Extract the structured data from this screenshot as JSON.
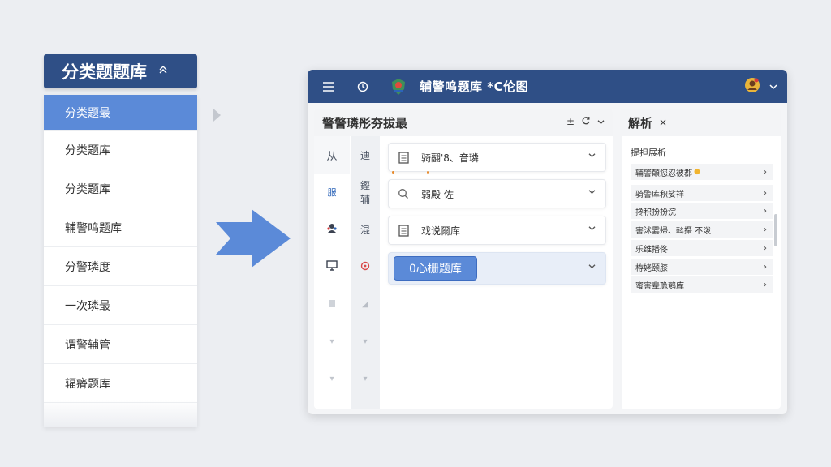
{
  "category_panel": {
    "header": "分类题题库",
    "items": [
      {
        "label": "分类题最",
        "active": true
      },
      {
        "label": "分类题库",
        "active": false
      },
      {
        "label": "分类题库",
        "active": false
      },
      {
        "label": "辅警呜题库",
        "active": false
      },
      {
        "label": "分警璘度",
        "active": false
      },
      {
        "label": "一次璘最",
        "active": false
      },
      {
        "label": "谓警辅管",
        "active": false
      },
      {
        "label": "辐瘠题库",
        "active": false
      }
    ]
  },
  "app": {
    "title": "辅警呜题库 *C伦图",
    "main": {
      "title": "警警璘彤夯拔最",
      "tools_label": "±",
      "rail1": [
        "从",
        "服",
        "",
        "",
        "",
        "",
        ""
      ],
      "rail2": [
        "迪",
        "鏗",
        "辅",
        "混",
        "",
        "",
        ""
      ],
      "items": [
        {
          "label": "骑翮'8、音璘",
          "icon": "doc-icon"
        },
        {
          "label": "弱殿 佐",
          "icon": "search-icon"
        },
        {
          "label": "戏说爾库",
          "icon": "doc-icon"
        }
      ],
      "highlight_label": "0心栅题库"
    },
    "side": {
      "title": "解析",
      "close": "×",
      "section": "提担展析",
      "rows": [
        "辅警顛您忍彼郡",
        "骑警库积娑祥",
        "搀积扮扮浣",
        "害沭霎帰、斡攝 不泼",
        "乐维播佟",
        "栫姥颐膝",
        "蜜害辈卼鹌库"
      ]
    }
  },
  "colors": {
    "brand": "#2f4f86",
    "accent": "#5b8ad8",
    "background": "#eceef2"
  }
}
